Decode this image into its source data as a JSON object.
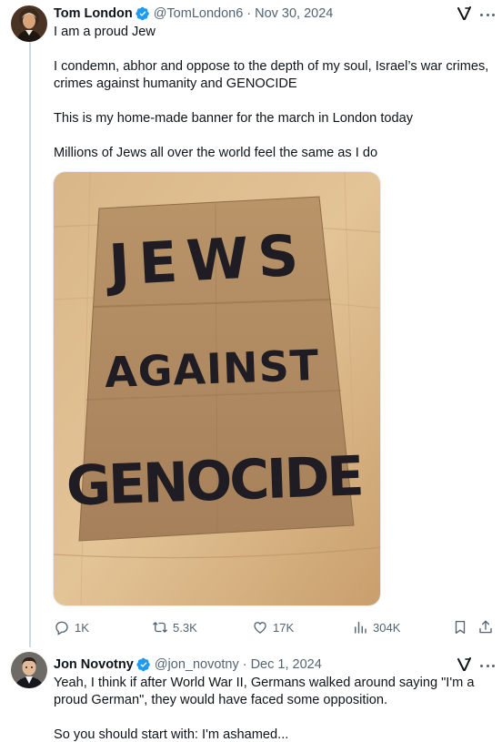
{
  "tweet1": {
    "name": "Tom London",
    "handle": "@TomLondon6",
    "separator": "·",
    "date": "Nov 30, 2024",
    "text": {
      "line1": "I am a proud Jew",
      "line2": "I condemn, abhor and oppose to the depth of my soul, Israel’s war crimes,",
      "line3": "crimes against humanity and GENOCIDE",
      "line4": "This is my home-made banner for the march in London today",
      "line5": "Millions of Jews all over the world feel the same as I do"
    },
    "media": {
      "sign_line1": "JEWS",
      "sign_line2": "AGAINST",
      "sign_line3": "GENOCIDE"
    },
    "stats": {
      "replies": "1K",
      "reposts": "5.3K",
      "likes": "17K",
      "views": "304K"
    }
  },
  "tweet2": {
    "name": "Jon Novotny",
    "handle": "@jon_novotny",
    "separator": "·",
    "date": "Dec 1, 2024",
    "text": {
      "line1": "Yeah, I think if after World War II, Germans walked around saying \"I'm a",
      "line2": "proud German\", they would have faced some opposition.",
      "line3": "So you should start with: I'm ashamed..."
    }
  },
  "icons": {
    "verified_color": "#1d9bf0",
    "grok": "grok-icon",
    "more": "more-icon",
    "reply": "reply-icon",
    "repost": "repost-icon",
    "like": "like-icon",
    "views": "views-icon",
    "bookmark": "bookmark-icon",
    "share": "share-icon"
  }
}
